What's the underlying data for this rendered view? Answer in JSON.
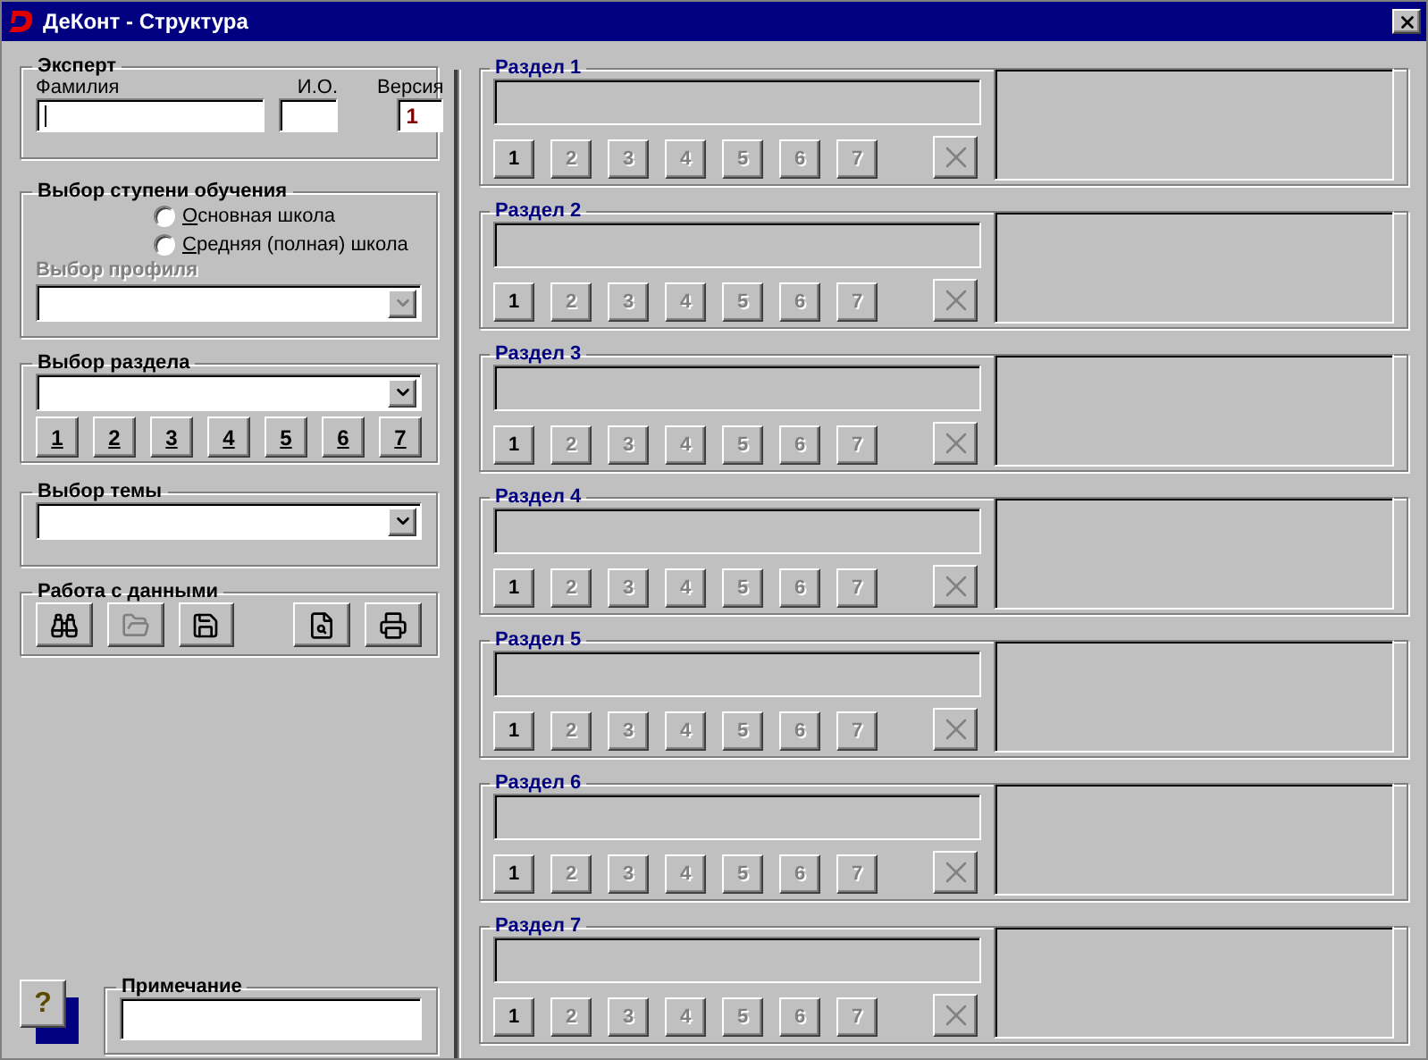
{
  "window": {
    "title": "ДеКонт - Структура"
  },
  "expert": {
    "title": "Эксперт",
    "fields": [
      {
        "label": "Фамилия",
        "focused": true
      },
      {
        "label": "И.О.",
        "focused": false
      },
      {
        "label": "Версия",
        "value": "1",
        "focused": false
      }
    ]
  },
  "level": {
    "title": "Выбор ступени обучения",
    "options": [
      {
        "label": "Основная школа",
        "selected": false
      },
      {
        "label": "Средняя (полная) школа",
        "selected": false
      }
    ],
    "profile": {
      "label": "Выбор профиля",
      "disabled": true
    }
  },
  "section_chooser": {
    "title": "Выбор раздела",
    "buttons": [
      {
        "label": "1"
      },
      {
        "label": "2"
      },
      {
        "label": "3"
      },
      {
        "label": "4"
      },
      {
        "label": "5"
      },
      {
        "label": "6"
      },
      {
        "label": "7"
      }
    ]
  },
  "topic_chooser": {
    "title": "Выбор темы"
  },
  "data_tools": {
    "title": "Работа с данными",
    "tools": [
      {
        "kind": "find",
        "disabled": false
      },
      {
        "kind": "open",
        "disabled": true
      },
      {
        "kind": "save",
        "disabled": false
      },
      {
        "kind": "preview",
        "disabled": false
      },
      {
        "kind": "print",
        "disabled": false
      }
    ]
  },
  "help": {
    "label": "?"
  },
  "note": {
    "title": "Примечание"
  },
  "sections": [
    {
      "title": "Раздел 1",
      "delete_disabled": true,
      "buttons": [
        {
          "label": "1",
          "disabled": false
        },
        {
          "label": "2",
          "disabled": true
        },
        {
          "label": "3",
          "disabled": true
        },
        {
          "label": "4",
          "disabled": true
        },
        {
          "label": "5",
          "disabled": true
        },
        {
          "label": "6",
          "disabled": true
        },
        {
          "label": "7",
          "disabled": true
        }
      ]
    },
    {
      "title": "Раздел 2",
      "delete_disabled": true,
      "buttons": [
        {
          "label": "1",
          "disabled": false
        },
        {
          "label": "2",
          "disabled": true
        },
        {
          "label": "3",
          "disabled": true
        },
        {
          "label": "4",
          "disabled": true
        },
        {
          "label": "5",
          "disabled": true
        },
        {
          "label": "6",
          "disabled": true
        },
        {
          "label": "7",
          "disabled": true
        }
      ]
    },
    {
      "title": "Раздел 3",
      "delete_disabled": true,
      "buttons": [
        {
          "label": "1",
          "disabled": false
        },
        {
          "label": "2",
          "disabled": true
        },
        {
          "label": "3",
          "disabled": true
        },
        {
          "label": "4",
          "disabled": true
        },
        {
          "label": "5",
          "disabled": true
        },
        {
          "label": "6",
          "disabled": true
        },
        {
          "label": "7",
          "disabled": true
        }
      ]
    },
    {
      "title": "Раздел 4",
      "delete_disabled": true,
      "buttons": [
        {
          "label": "1",
          "disabled": false
        },
        {
          "label": "2",
          "disabled": true
        },
        {
          "label": "3",
          "disabled": true
        },
        {
          "label": "4",
          "disabled": true
        },
        {
          "label": "5",
          "disabled": true
        },
        {
          "label": "6",
          "disabled": true
        },
        {
          "label": "7",
          "disabled": true
        }
      ]
    },
    {
      "title": "Раздел 5",
      "delete_disabled": true,
      "buttons": [
        {
          "label": "1",
          "disabled": false
        },
        {
          "label": "2",
          "disabled": true
        },
        {
          "label": "3",
          "disabled": true
        },
        {
          "label": "4",
          "disabled": true
        },
        {
          "label": "5",
          "disabled": true
        },
        {
          "label": "6",
          "disabled": true
        },
        {
          "label": "7",
          "disabled": true
        }
      ]
    },
    {
      "title": "Раздел 6",
      "delete_disabled": true,
      "buttons": [
        {
          "label": "1",
          "disabled": false
        },
        {
          "label": "2",
          "disabled": true
        },
        {
          "label": "3",
          "disabled": true
        },
        {
          "label": "4",
          "disabled": true
        },
        {
          "label": "5",
          "disabled": true
        },
        {
          "label": "6",
          "disabled": true
        },
        {
          "label": "7",
          "disabled": true
        }
      ]
    },
    {
      "title": "Раздел 7",
      "delete_disabled": true,
      "buttons": [
        {
          "label": "1",
          "disabled": false
        },
        {
          "label": "2",
          "disabled": true
        },
        {
          "label": "3",
          "disabled": true
        },
        {
          "label": "4",
          "disabled": true
        },
        {
          "label": "5",
          "disabled": true
        },
        {
          "label": "6",
          "disabled": true
        },
        {
          "label": "7",
          "disabled": true
        }
      ]
    }
  ]
}
